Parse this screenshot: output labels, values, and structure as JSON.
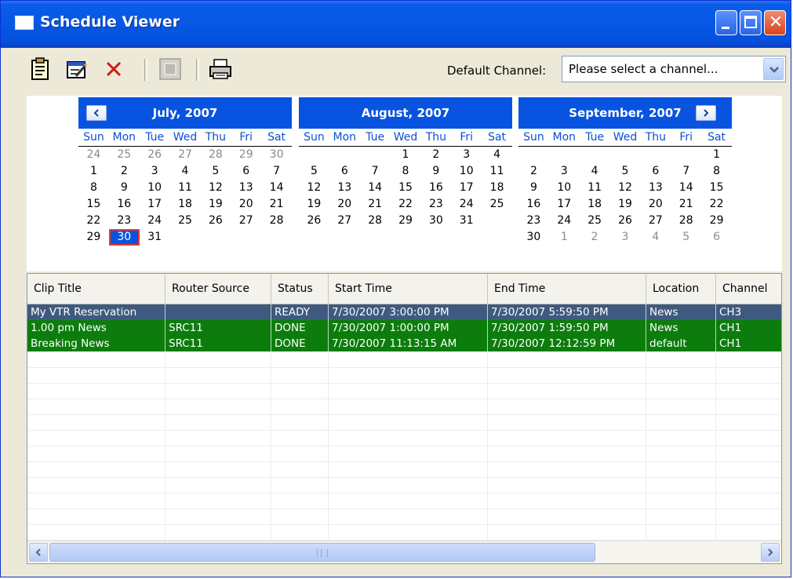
{
  "window": {
    "title": "Schedule Viewer"
  },
  "toolbar": {
    "channel_label": "Default Channel:",
    "channel_select": {
      "value": "Please select a channel..."
    }
  },
  "calendar": {
    "months": [
      {
        "title": "July, 2007",
        "days": [
          "24",
          "25",
          "26",
          "27",
          "28",
          "29",
          "30",
          "1",
          "2",
          "3",
          "4",
          "5",
          "6",
          "7",
          "8",
          "9",
          "10",
          "11",
          "12",
          "13",
          "14",
          "15",
          "16",
          "17",
          "18",
          "19",
          "20",
          "21",
          "22",
          "23",
          "24",
          "25",
          "26",
          "27",
          "28",
          "29",
          "30",
          "31"
        ],
        "other_month_count_before": 7,
        "other_month_count_after": 0,
        "selected_day": "30"
      },
      {
        "title": "August, 2007",
        "days": [
          "1",
          "2",
          "3",
          "4",
          "5",
          "6",
          "7",
          "8",
          "9",
          "10",
          "11",
          "12",
          "13",
          "14",
          "15",
          "16",
          "17",
          "18",
          "19",
          "20",
          "21",
          "22",
          "23",
          "24",
          "25",
          "26",
          "27",
          "28",
          "29",
          "30",
          "31"
        ],
        "leading_blanks": 3,
        "other_month_count_before": 0,
        "other_month_count_after": 0
      },
      {
        "title": "September, 2007",
        "days": [
          "1",
          "2",
          "3",
          "4",
          "5",
          "6",
          "7",
          "8",
          "9",
          "10",
          "11",
          "12",
          "13",
          "14",
          "15",
          "16",
          "17",
          "18",
          "19",
          "20",
          "21",
          "22",
          "23",
          "24",
          "25",
          "26",
          "27",
          "28",
          "29",
          "30",
          "1",
          "2",
          "3",
          "4",
          "5",
          "6"
        ],
        "leading_blanks": 6,
        "other_month_count_before": 0,
        "other_month_count_after": 6
      }
    ],
    "weekdays": [
      "Sun",
      "Mon",
      "Tue",
      "Wed",
      "Thu",
      "Fri",
      "Sat"
    ]
  },
  "table": {
    "columns": [
      "Clip Title",
      "Router Source",
      "Status",
      "Start Time",
      "End Time",
      "Location",
      "Channel"
    ],
    "rows": [
      {
        "status_class": "ready",
        "cells": [
          "My VTR Reservation",
          "",
          "READY",
          "7/30/2007 3:00:00 PM",
          "7/30/2007 5:59:50 PM",
          "News",
          "CH3"
        ]
      },
      {
        "status_class": "done",
        "cells": [
          "1.00 pm News",
          "SRC11",
          "DONE",
          "7/30/2007 1:00:00 PM",
          "7/30/2007 1:59:50 PM",
          "News",
          "CH1"
        ]
      },
      {
        "status_class": "done",
        "cells": [
          "Breaking News",
          "SRC11",
          "DONE",
          "7/30/2007 11:13:15 AM",
          "7/30/2007 12:12:59 PM",
          "default",
          "CH1"
        ]
      }
    ],
    "status_colors": {
      "ready": "#3f5a7f",
      "done": "#0c7d0c"
    }
  },
  "icons": {
    "toolbar": [
      "new-schedule-icon",
      "edit-schedule-icon",
      "delete-icon",
      "stop-icon",
      "print-icon"
    ]
  }
}
